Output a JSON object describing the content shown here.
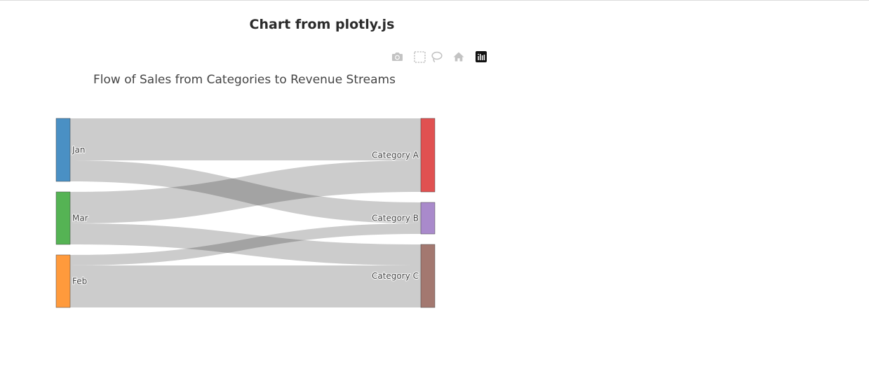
{
  "page": {
    "heading": "Chart from plotly.js"
  },
  "modebar": {
    "buttons": [
      {
        "icon": "camera-icon",
        "label": "Download plot as a png"
      },
      {
        "icon": "box-select-icon",
        "label": "Box Select"
      },
      {
        "icon": "lasso-select-icon",
        "label": "Lasso Select"
      },
      {
        "icon": "home-icon",
        "label": "Reset view"
      },
      {
        "icon": "plotly-logo-icon",
        "label": "Produced with Plotly"
      }
    ]
  },
  "chart_data": {
    "type": "sankey",
    "title": "Flow of Sales from Categories to Revenue Streams",
    "nodes": [
      {
        "label": "Jan",
        "color": "#4a90c4"
      },
      {
        "label": "Mar",
        "color": "#55b354"
      },
      {
        "label": "Feb",
        "color": "#ff9a3c"
      },
      {
        "label": "Category A",
        "color": "#e05151"
      },
      {
        "label": "Category B",
        "color": "#a98acb"
      },
      {
        "label": "Category C",
        "color": "#a37870"
      }
    ],
    "links": [
      {
        "source": "Jan",
        "target": "Category A",
        "value": 20
      },
      {
        "source": "Jan",
        "target": "Category B",
        "value": 10
      },
      {
        "source": "Mar",
        "target": "Category A",
        "value": 15
      },
      {
        "source": "Mar",
        "target": "Category C",
        "value": 10
      },
      {
        "source": "Feb",
        "target": "Category B",
        "value": 5
      },
      {
        "source": "Feb",
        "target": "Category C",
        "value": 20
      }
    ],
    "link_color": "rgba(0,0,0,0.2)"
  }
}
